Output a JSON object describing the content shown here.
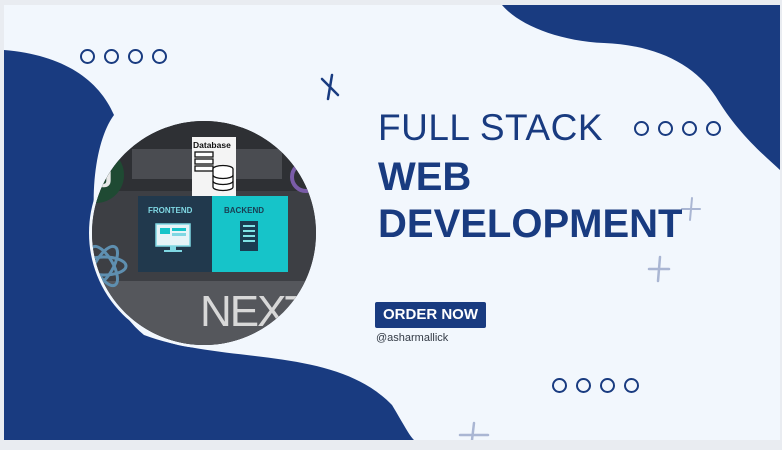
{
  "banner": {
    "title_line1": "FULL STACK",
    "title_line2": "WEB",
    "title_line3": "DEVELOPMENT",
    "order_button": "ORDER NOW",
    "handle": "@asharmallick"
  },
  "image": {
    "database_label": "Database",
    "frontend_label": "FRONTEND",
    "backend_label": "BACKEND",
    "logo_text": "NEXT"
  },
  "colors": {
    "navy": "#193b80",
    "background": "#f2f7fd",
    "teal": "#16c4c9"
  },
  "icons": [
    "circle-outline-icon",
    "cross-icon",
    "monitor-icon",
    "server-icon",
    "database-icon",
    "react-icon"
  ]
}
